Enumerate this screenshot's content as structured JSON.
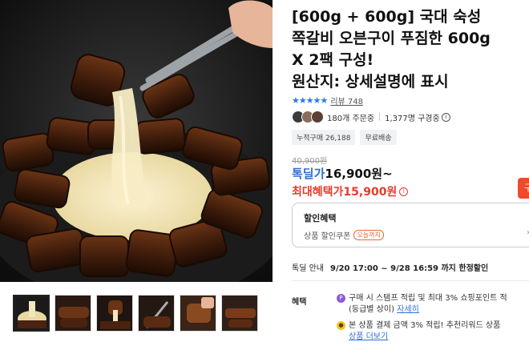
{
  "product": {
    "title_lines": [
      "[600g + 600g] 국대 숙성",
      "쪽갈비 오븐구이 푸짐한 600g",
      "X 2팩 구성!",
      "원산지: 상세설명에 표시"
    ],
    "rating_stars": "★★★★★",
    "review_label": "리뷰 748",
    "buyers_orders": "180개 주문중",
    "buyers_watching": "1,377명 구경중",
    "tags": [
      "누적구매 26,188",
      "무료배송"
    ],
    "original_price": "40,900원",
    "deal_label": "톡딜가",
    "deal_price": "16,900원~",
    "max_label": "최대혜택가",
    "max_price": "15,900원",
    "buy_button": "구"
  },
  "discount": {
    "title": "할인혜택",
    "coupon_label": "상품 할인쿠폰",
    "coupon_badge": "오늘까지"
  },
  "deadline": {
    "label": "톡딜 안내",
    "value": "9/20 17:00 ~ 9/28 16:59 까지 한정할인"
  },
  "benefits": {
    "label": "혜택",
    "item1_line1": "구매 시 스탬프 적립 및 최대 3% 쇼핑포인트 적",
    "item1_line2": "(등급별 상이)",
    "item1_link": "자세히",
    "item2_line1": "본 상품 결제 금액 3% 적립! 추천리워드 상품",
    "item2_link": "상품 더보기"
  },
  "icons": {
    "info": "info-circle-icon",
    "chevron": "chevron-right-icon",
    "point": "point-icon",
    "reward": "reward-icon"
  },
  "thumbnails": [
    "thumb-1",
    "thumb-2",
    "thumb-3",
    "thumb-4",
    "thumb-5",
    "thumb-6"
  ],
  "colors": {
    "deal_blue": "#2f6fd6",
    "price_red": "#e53b2c",
    "star_blue": "#2f77e5",
    "buy_button": "#f04a2c"
  }
}
